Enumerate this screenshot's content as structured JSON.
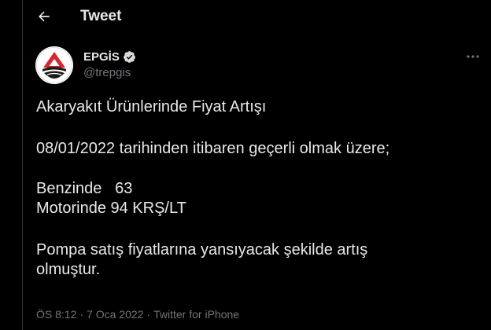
{
  "header": {
    "title": "Tweet"
  },
  "tweet": {
    "author": {
      "name": "EPGİS",
      "handle": "@trepgis"
    },
    "lines": {
      "title": "Akaryakıt Ürünlerinde Fiyat Artışı",
      "date_line": "08/01/2022 tarihinden itibaren geçerli olmak üzere;",
      "benzin": "Benzinde   63",
      "motorin": "Motorinde 94 KRŞ/LT",
      "closing_1": "Pompa satış fiyatlarına yansıyacak şekilde artış",
      "closing_2": "olmuştur."
    },
    "meta": {
      "time": "ÖS 8:12",
      "date": "7 Oca 2022",
      "source": "Twitter for iPhone",
      "separator": "·"
    }
  },
  "icons": {
    "back": "back-arrow-icon",
    "verified": "verified-badge-icon",
    "more": "more-dots-icon"
  },
  "colors": {
    "background": "#000000",
    "text": "#e7e9ea",
    "muted": "#71767b",
    "border": "#2f3336",
    "avatar_red": "#d7262e"
  }
}
